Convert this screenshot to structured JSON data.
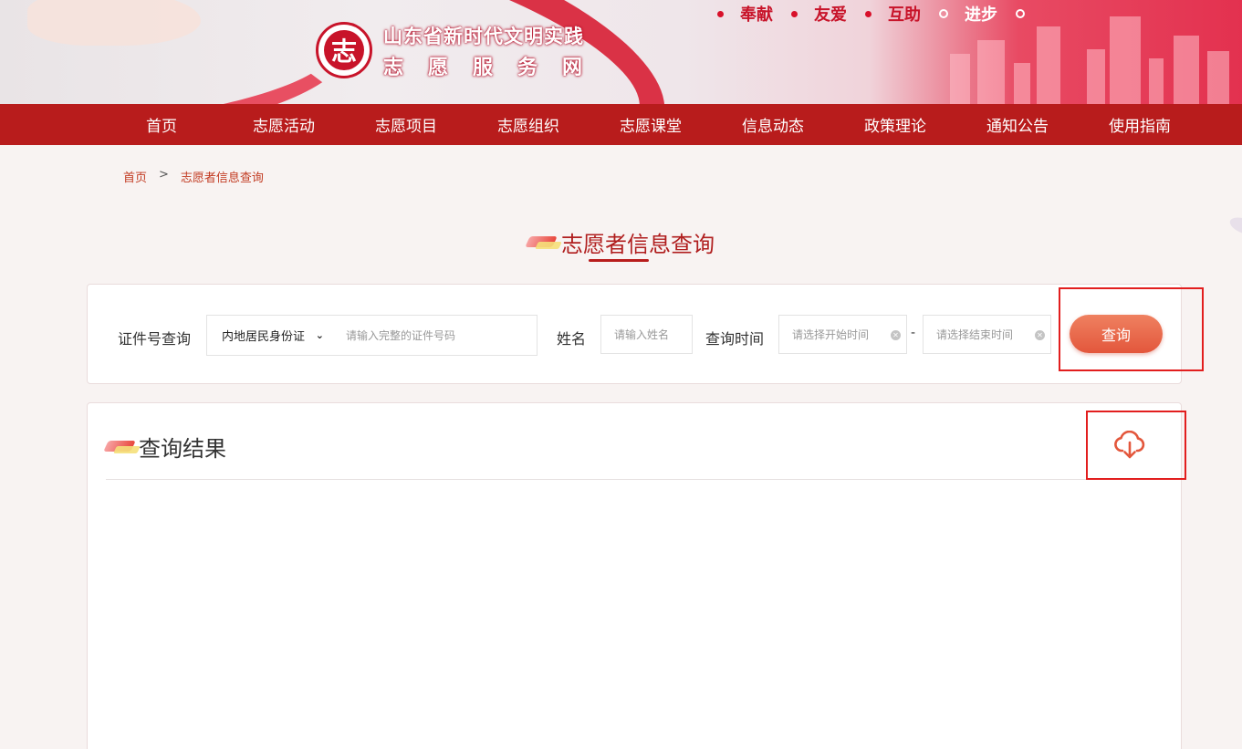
{
  "banner": {
    "site_title": "山东省新时代文明实践",
    "site_subtitle": "志愿服务网",
    "seal_char": "志",
    "slogans": [
      "奉献",
      "友爱",
      "互助",
      "进步"
    ]
  },
  "nav": {
    "items": [
      "首页",
      "志愿活动",
      "志愿项目",
      "志愿组织",
      "志愿课堂",
      "信息动态",
      "政策理论",
      "通知公告",
      "使用指南"
    ]
  },
  "breadcrumb": {
    "home": "首页",
    "separator": ">",
    "current": "志愿者信息查询"
  },
  "page": {
    "title": "志愿者信息查询"
  },
  "search": {
    "id_label": "证件号查询",
    "id_type_selected": "内地居民身份证",
    "id_placeholder": "请输入完整的证件号码",
    "name_label": "姓名",
    "name_placeholder": "请输入姓名",
    "time_label": "查询时间",
    "start_placeholder": "请选择开始时间",
    "range_separator": "-",
    "end_placeholder": "请选择结束时间",
    "query_button": "查询"
  },
  "results": {
    "title": "查询结果",
    "download_icon": "cloud-download-icon"
  },
  "colors": {
    "nav_red": "#b81c1c",
    "accent_orange": "#e3573c",
    "highlight_red": "#e21e1e"
  }
}
